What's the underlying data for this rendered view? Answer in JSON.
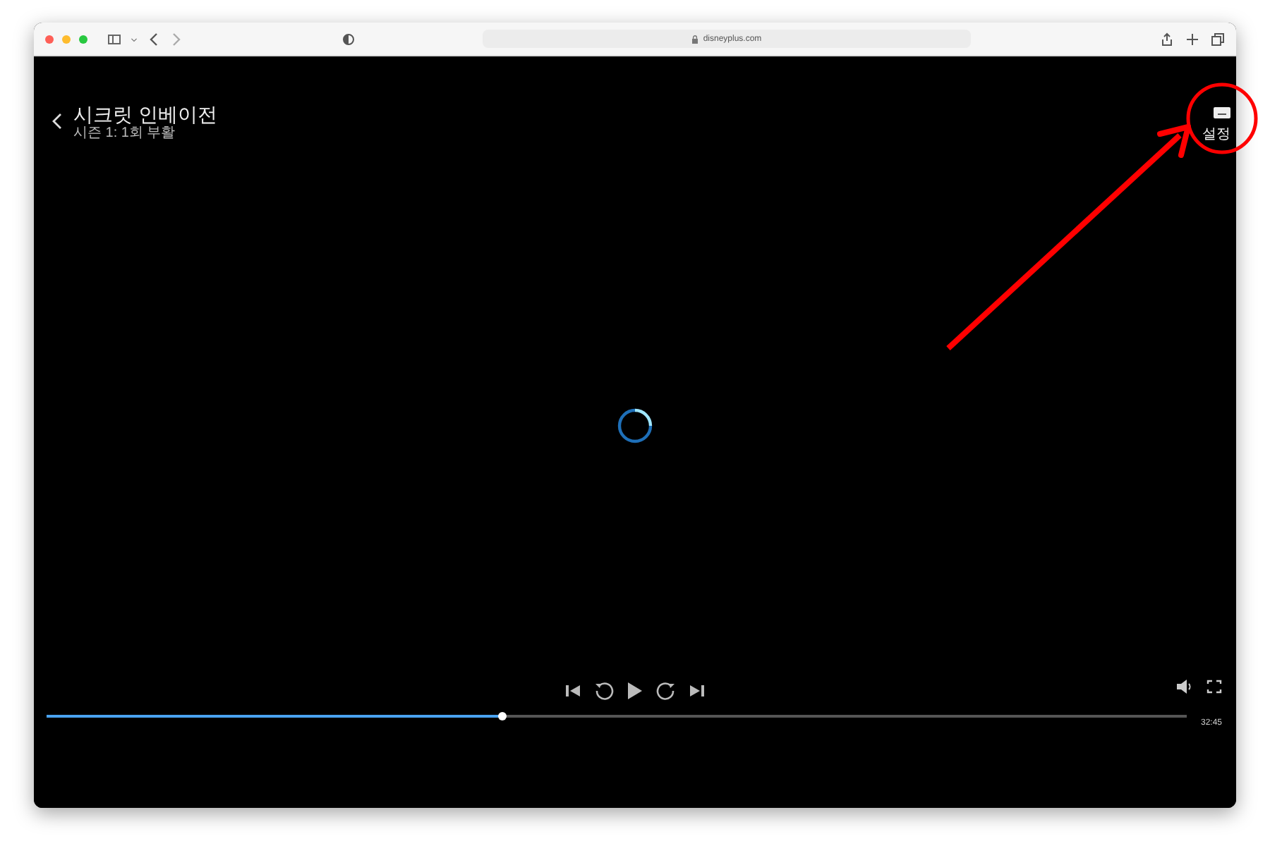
{
  "browser": {
    "address": "disneyplus.com"
  },
  "player": {
    "title": "시크릿 인베이전",
    "subtitle": "시즌 1: 1회 부활",
    "settings_label": "설정",
    "progress": {
      "level": 0.4
    },
    "duration": "32:45",
    "loading": true
  },
  "annotation": {
    "kind": "arrow-circle",
    "color": "#ff0000"
  }
}
